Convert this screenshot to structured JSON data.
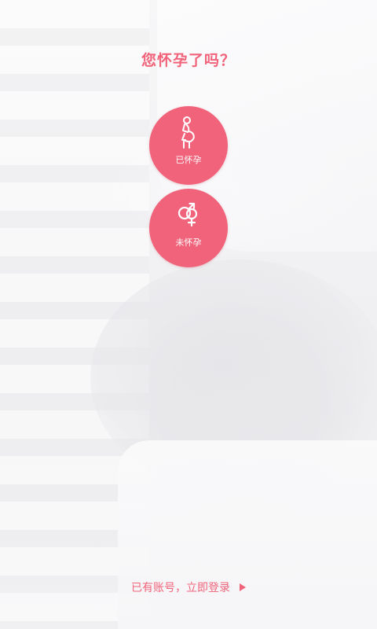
{
  "question": {
    "title": "您怀孕了吗？"
  },
  "choices": [
    {
      "label": "已怀孕",
      "icon": "pregnant-woman-icon"
    },
    {
      "label": "未怀孕",
      "icon": "gender-symbols-icon"
    }
  ],
  "login": {
    "text": "已有账号，立即登录",
    "icon": "arrow-right-icon"
  },
  "colors": {
    "accent": "#f0637a",
    "background": "#f4f4f6",
    "on_accent": "#ffffff"
  }
}
